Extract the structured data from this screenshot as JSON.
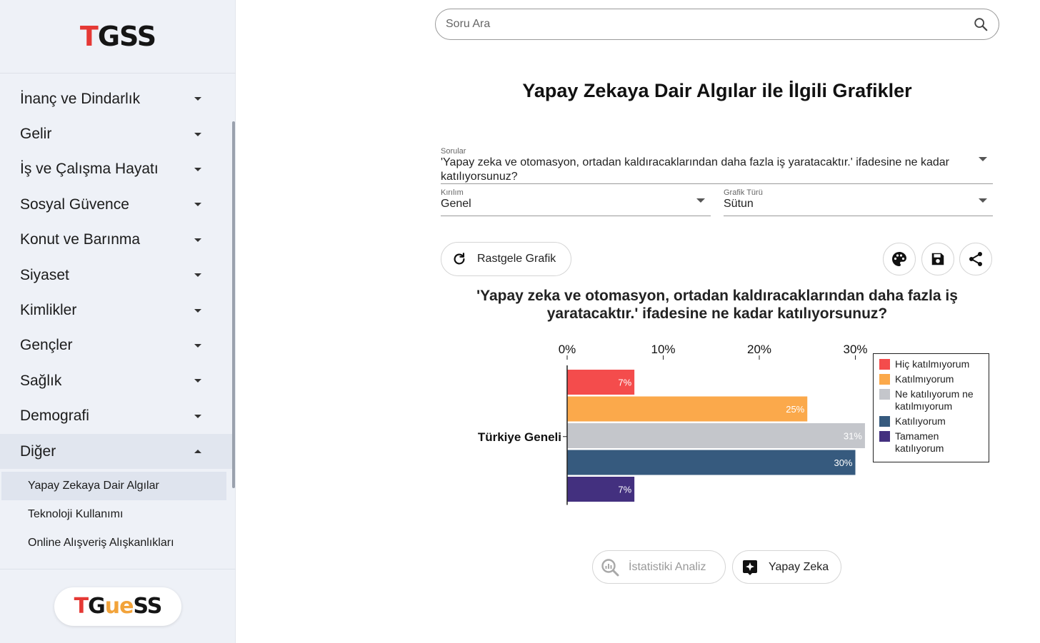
{
  "sidebar": {
    "logo": {
      "prefix": "T",
      "rest": "GSS"
    },
    "items": [
      {
        "label": "İnanç ve Dindarlık"
      },
      {
        "label": "Gelir"
      },
      {
        "label": "İş ve Çalışma Hayatı"
      },
      {
        "label": "Sosyal Güvence"
      },
      {
        "label": "Konut ve Barınma"
      },
      {
        "label": "Siyaset"
      },
      {
        "label": "Kimlikler"
      },
      {
        "label": "Gençler"
      },
      {
        "label": "Sağlık"
      },
      {
        "label": "Demografi"
      },
      {
        "label": "Diğer"
      }
    ],
    "subitems": [
      {
        "label": "Yapay Zekaya Dair Algılar"
      },
      {
        "label": "Teknoloji Kullanımı"
      },
      {
        "label": "Online Alışveriş Alışkanlıkları"
      }
    ],
    "bottom_logo": {
      "t": "T",
      "g": "G",
      "ue": "ue",
      "ss": "SS"
    }
  },
  "search": {
    "placeholder": "Soru Ara"
  },
  "page_title": "Yapay Zekaya Dair Algılar ile İlgili Grafikler",
  "filters": {
    "questions": {
      "label": "Sorular",
      "value": "'Yapay zeka ve otomasyon, ortadan kaldıracaklarından daha fazla iş yaratacaktır.' ifadesine ne kadar katılıyorsunuz?"
    },
    "breakdown": {
      "label": "Kırılım",
      "value": "Genel"
    },
    "chart_type": {
      "label": "Grafik Türü",
      "value": "Sütun"
    }
  },
  "buttons": {
    "random": "Rastgele Grafik",
    "stats": "İstatistiki Analiz",
    "ai": "Yapay Zeka"
  },
  "colors": {
    "accent_red": "#e53935",
    "accent_orange": "#f2a33a"
  },
  "chart_data": {
    "type": "bar",
    "orientation": "horizontal",
    "title": "'Yapay zeka ve otomasyon, ortadan kaldıracaklarından daha fazla iş yaratacaktır.' ifadesine ne kadar katılıyorsunuz?",
    "categories": [
      "Türkiye Geneli"
    ],
    "xlim": [
      0,
      30
    ],
    "xticks": [
      "0%",
      "10%",
      "20%",
      "30%"
    ],
    "legend_position": "right",
    "series": [
      {
        "name": "Hiç katılmıyorum",
        "values": [
          7
        ],
        "label": "7%",
        "color": "#f44c4c"
      },
      {
        "name": "Katılmıyorum",
        "values": [
          25
        ],
        "label": "25%",
        "color": "#fba94b"
      },
      {
        "name": "Ne katılıyorum ne katılmıyorum",
        "values": [
          31
        ],
        "label": "31%",
        "color": "#c4c6cb"
      },
      {
        "name": "Katılıyorum",
        "values": [
          30
        ],
        "label": "30%",
        "color": "#365a7e"
      },
      {
        "name": "Tamamen katılıyorum",
        "values": [
          7
        ],
        "label": "7%",
        "color": "#43307f"
      }
    ]
  }
}
